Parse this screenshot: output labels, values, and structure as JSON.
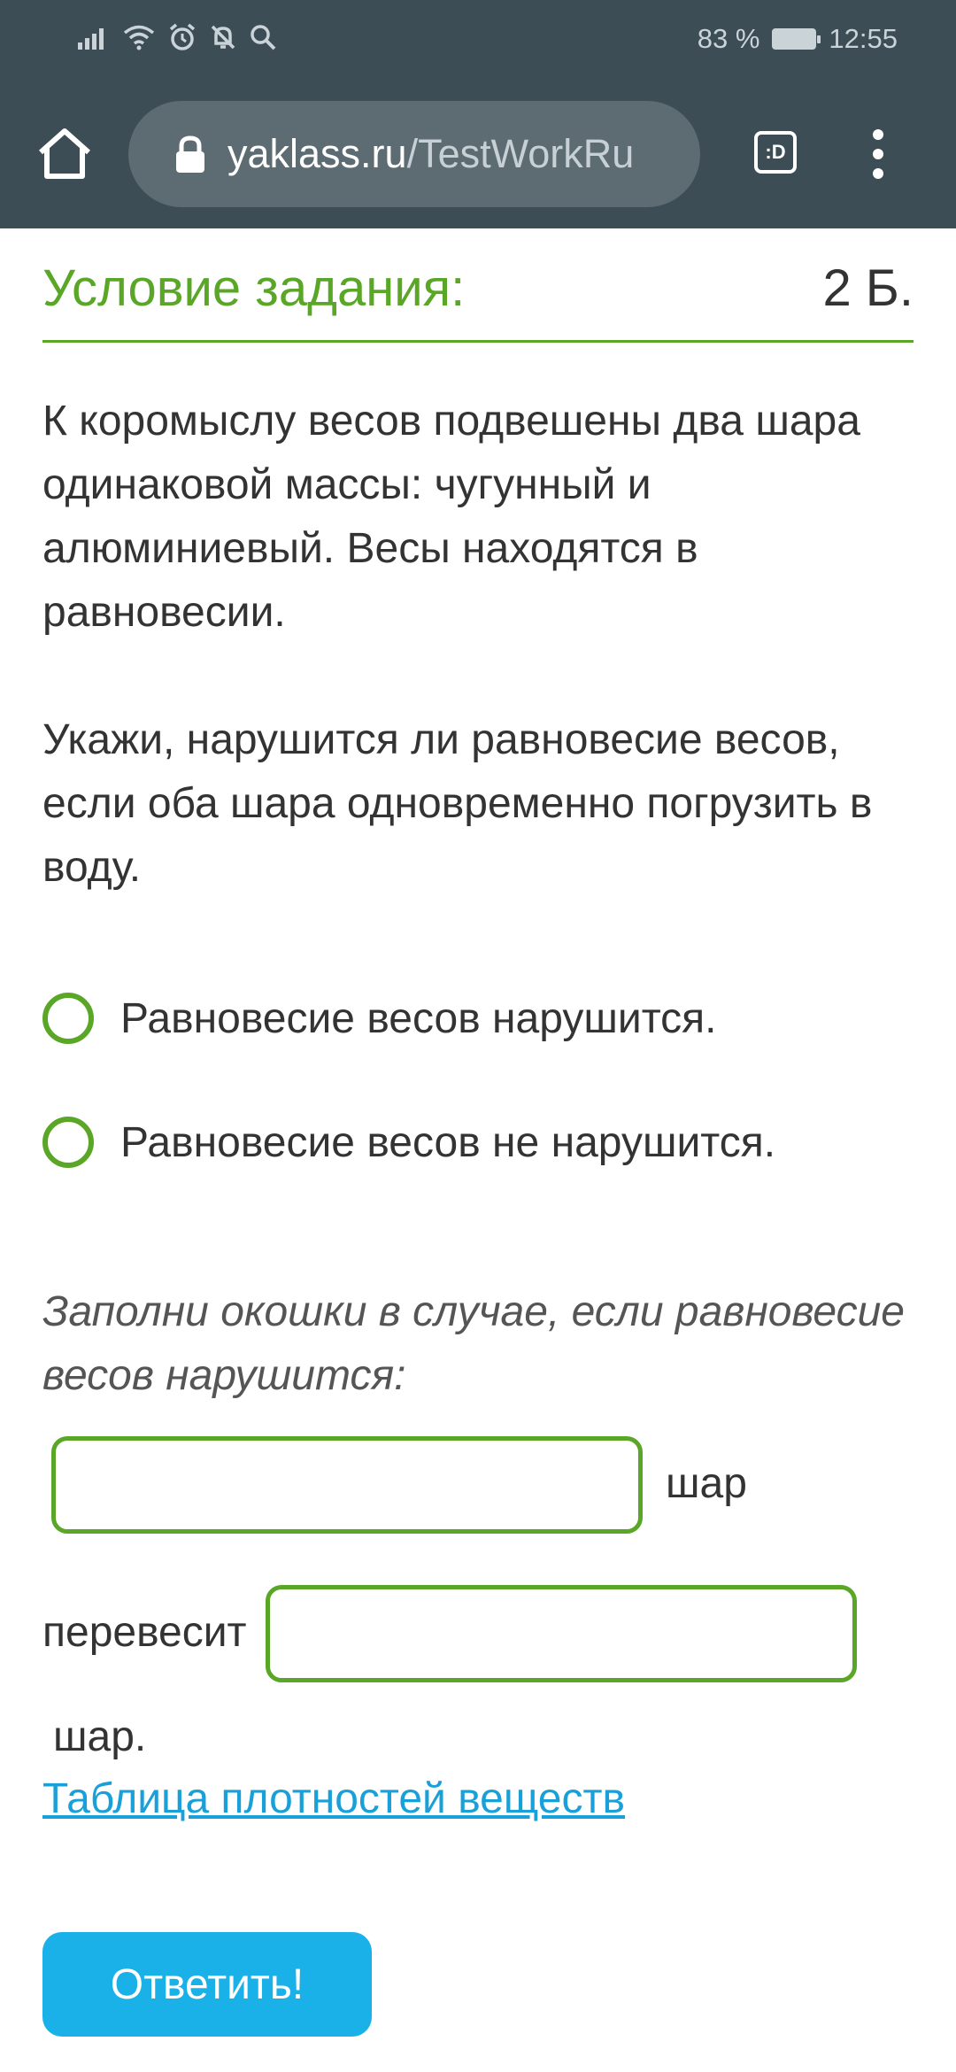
{
  "status_bar": {
    "battery": "83 %",
    "time": "12:55",
    "icons": [
      "signal-icon",
      "wifi-icon",
      "alarm-icon",
      "mute-bell-icon",
      "search-icon"
    ]
  },
  "browser": {
    "url_domain": "yaklass.ru",
    "url_path": "/TestWorkRu",
    "tab_switcher_label": ":D"
  },
  "task": {
    "title": "Условие задания:",
    "score": "2 Б.",
    "paragraph_1": "К коромыслу весов подвешены два шара одинаковой массы: чугунный и алюминиевый. Весы находятся в равновесии.",
    "paragraph_2": "Укажи, нарушится ли равновесие весов, если оба шара одновременно погрузить в воду.",
    "options": [
      {
        "label": "Равновесие весов нарушится."
      },
      {
        "label": "Равновесие весов не нарушится."
      }
    ],
    "instruction": "Заполни окошки в случае, если равновесие весов нарушится:",
    "field_1_value": "",
    "suffix_1": "шар",
    "prefix_2": "перевесит",
    "field_2_value": "",
    "suffix_2": "шар.",
    "link_text": "Таблица плотностей веществ",
    "submit_label": "Ответить!"
  },
  "colors": {
    "topbar": "#3c4d55",
    "url_pill": "#5d6c73",
    "accent_green": "#5aa626",
    "link_blue": "#1aa0d8",
    "button_blue": "#1ab0e8"
  }
}
